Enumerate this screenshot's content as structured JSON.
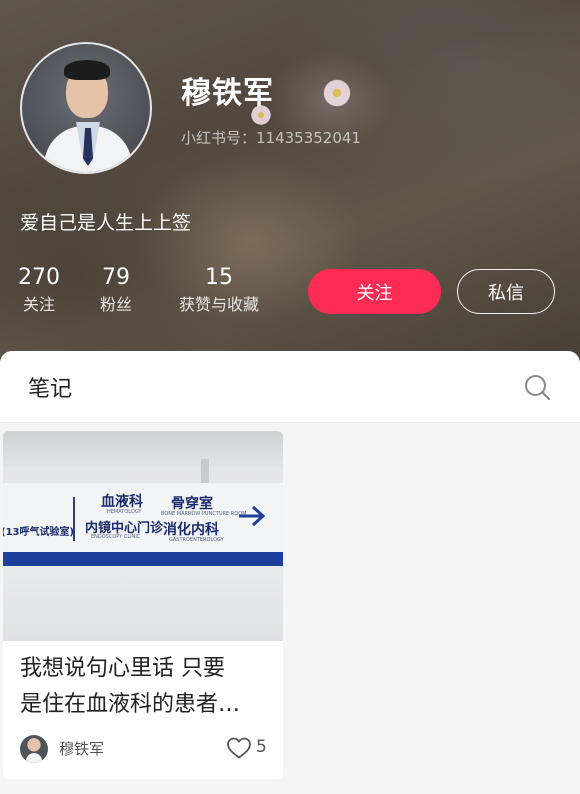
{
  "profile": {
    "name": "穆铁军",
    "red_id": "小红书号：11435352041",
    "signature": "爱自己是人生上上签",
    "stats": [
      {
        "num": "270",
        "label": "关注"
      },
      {
        "num": "79",
        "label": "粉丝"
      },
      {
        "num": "15",
        "label": "获赞与收藏"
      }
    ],
    "follow_label": "关注",
    "message_label": "私信"
  },
  "tabs": {
    "notes_label": "笔记",
    "search_icon": "search-icon"
  },
  "colors": {
    "accent": "#fe2c55",
    "sign_blue": "#1f3f9c"
  },
  "notes": [
    {
      "cover_sign": {
        "left_text": "(13呼气试验室)",
        "item1": "血液科",
        "item1_en": "HEMATOLOGY",
        "item2": "骨穿室",
        "item2_en": "BONE MARROW PUNCTURE ROOM",
        "item3": "内镜中心门诊",
        "item3_en": "ENDOSCOPY CLINIC",
        "item4": "消化内科",
        "item4_en": "GASTROENTEROLOGY"
      },
      "title_line1": "我想说句心里话 只要",
      "title_line2": "是住在血液科的患者…",
      "author": "穆铁军",
      "likes": "5"
    }
  ]
}
